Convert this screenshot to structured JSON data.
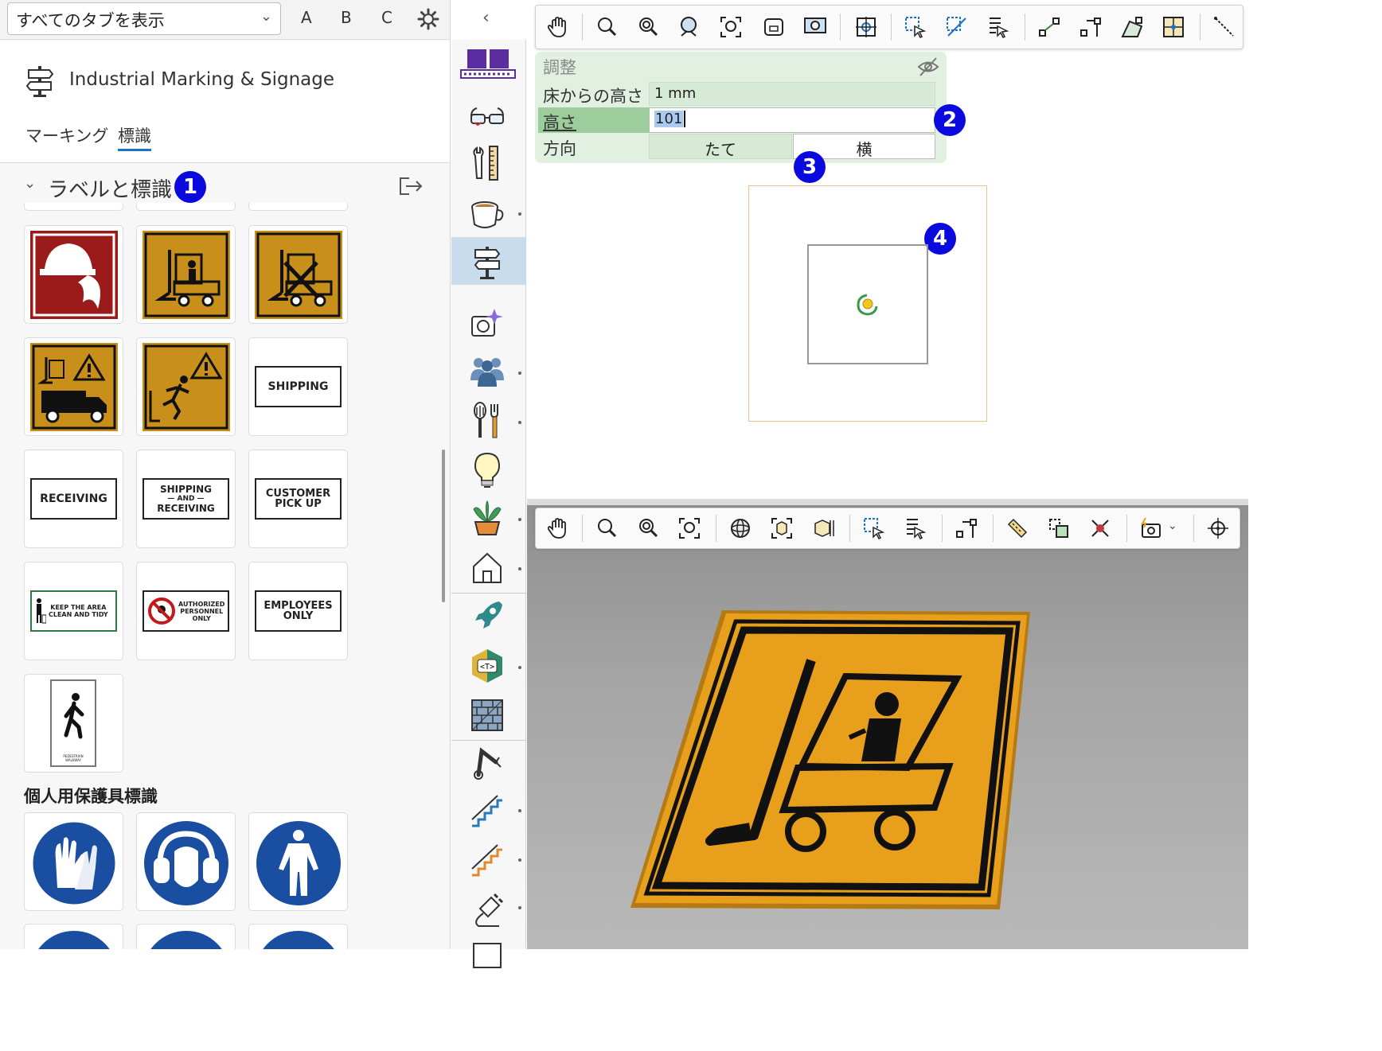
{
  "left_panel": {
    "tab_select_value": "すべてのタブを表示",
    "letter_buttons": [
      "A",
      "B",
      "C"
    ],
    "library_title": "Industrial Marking & Signage",
    "tabs": [
      "マーキング",
      "標識"
    ],
    "active_tab": "標識",
    "category": "ラベルと標識",
    "text_signs": {
      "shipping": "SHIPPING",
      "receiving": "RECEIVING",
      "shipping_receiving": [
        "SHIPPING",
        "— AND —",
        "RECEIVING"
      ],
      "customer_pickup": [
        "CUSTOMER",
        "PICK UP"
      ],
      "keep_area": [
        "KEEP THE AREA",
        "CLEAN AND TIDY"
      ],
      "authorized": [
        "AUTHORIZED",
        "PERSONNEL",
        "ONLY"
      ],
      "employees_only": [
        "EMPLOYEES",
        "ONLY"
      ],
      "pedestrian": [
        "PEDESTRIAN",
        "WALKWAY"
      ]
    },
    "ppe_section": "個人用保護具標識"
  },
  "adjust_panel": {
    "title": "調整",
    "rows": [
      {
        "label": "床からの高さ",
        "value": "1 mm"
      },
      {
        "label": "高さ",
        "value": "101"
      }
    ],
    "direction_label": "方向",
    "direction_options": [
      "たて",
      "横"
    ]
  },
  "badges": [
    "1",
    "2",
    "3",
    "4"
  ],
  "colors": {
    "accent_blue": "#0a0adf",
    "panel_green": "#e2f0e2",
    "sign_amber": "#c8901a",
    "sign_red": "#9b1b1b",
    "ppe_blue": "#1a4ea0"
  }
}
